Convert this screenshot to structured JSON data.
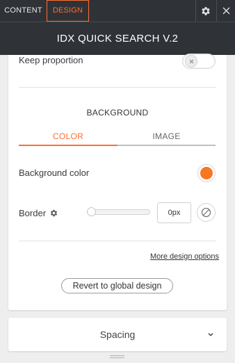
{
  "tabs": {
    "content_label": "CONTENT",
    "design_label": "DESIGN",
    "active": "DESIGN"
  },
  "icons": {
    "settings": "gear-icon",
    "close": "close-icon",
    "border_settings": "gear-icon",
    "reset": "no-symbol-icon",
    "toggle_off": "x-icon",
    "expand": "chevron-down-icon"
  },
  "header": {
    "title": "IDX QUICK SEARCH V.2"
  },
  "options": {
    "keep_proportion_label": "Keep proportion",
    "keep_proportion_enabled": false
  },
  "background": {
    "section_title": "BACKGROUND",
    "tabs": [
      "COLOR",
      "IMAGE"
    ],
    "active_tab": "COLOR",
    "color_label": "Background color",
    "color_value": "#f97723",
    "border_label": "Border",
    "border_value": "0px",
    "border_slider_level": 0
  },
  "links": {
    "more_design_options": "More design options"
  },
  "buttons": {
    "revert": "Revert to global design"
  },
  "spacing": {
    "label": "Spacing"
  },
  "colors": {
    "accent": "#ff6e30",
    "dark_bar": "#2f3337",
    "swatch": "#f97723"
  }
}
